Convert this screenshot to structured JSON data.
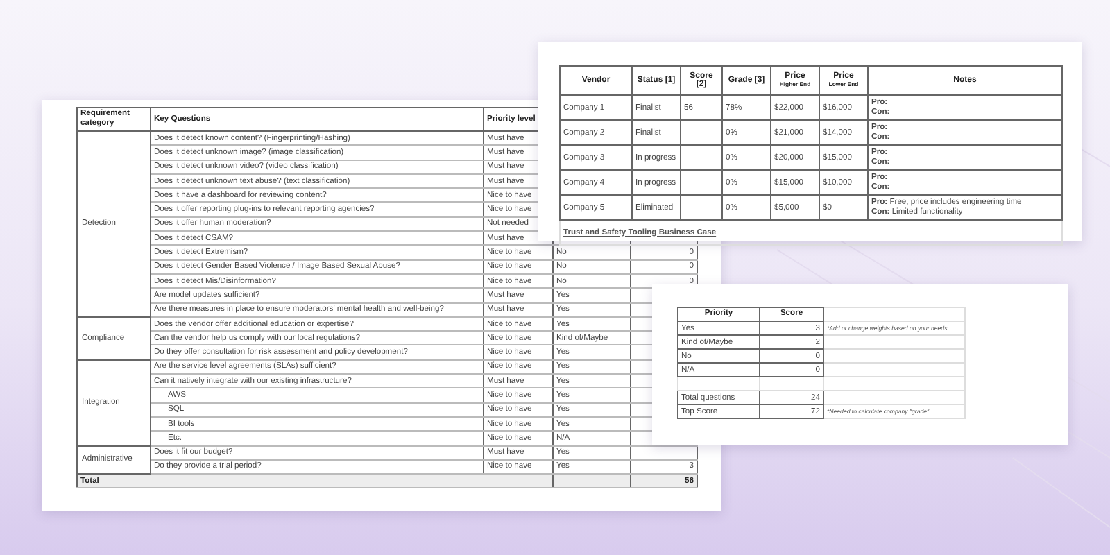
{
  "requirements_sheet": {
    "columns": [
      "Requirement category",
      "Key Questions",
      "Priority level"
    ],
    "categories": [
      {
        "name": "Detection",
        "rows": [
          {
            "question": "Does it detect known content? (Fingerprinting/Hashing)",
            "priority": "Must have"
          },
          {
            "question": "Does it detect unknown image? (image classification)",
            "priority": "Must have"
          },
          {
            "question": "Does it detect unknown video? (video classification)",
            "priority": "Must have"
          },
          {
            "question": "Does it detect unknown text abuse? (text classification)",
            "priority": "Must have"
          },
          {
            "question": "Does it have a dashboard for reviewing content?",
            "priority": "Nice to have"
          },
          {
            "question": "Does it offer reporting plug-ins to relevant reporting agencies?",
            "priority": "Nice to have"
          },
          {
            "question": "Does it offer human moderation?",
            "priority": "Not needed"
          },
          {
            "question": "Does it detect CSAM?",
            "priority": "Must have"
          },
          {
            "question": "Does it detect Extremism?",
            "priority": "Nice to have",
            "answer": "No",
            "score": "0"
          },
          {
            "question": "Does it detect Gender Based Violence / Image Based Sexual Abuse?",
            "priority": "Nice to have",
            "answer": "No",
            "score": "0"
          },
          {
            "question": "Does it detect Mis/Disinformation?",
            "priority": "Nice to have",
            "answer": "No",
            "score": "0"
          },
          {
            "question": "Are model updates sufficient?",
            "priority": "Must have",
            "answer": "Yes"
          },
          {
            "question": "Are there measures in place to ensure moderators' mental health and well-being?",
            "priority": "Must have",
            "answer": "Yes"
          }
        ]
      },
      {
        "name": "Compliance",
        "rows": [
          {
            "question": "Does the vendor offer additional education or expertise?",
            "priority": "Nice to have",
            "answer": "Yes"
          },
          {
            "question": "Can the vendor help us comply with our local regulations?",
            "priority": "Nice to have",
            "answer": "Kind of/Maybe"
          },
          {
            "question": "Do they offer consultation for risk assessment and policy development?",
            "priority": "Nice to have",
            "answer": "Yes"
          }
        ]
      },
      {
        "name": "Integration",
        "rows": [
          {
            "question": "Are the service level agreements (SLAs) sufficient?",
            "priority": "Nice to have",
            "answer": "Yes"
          },
          {
            "question": "Can it natively integrate with our existing infrastructure?",
            "priority": "Must have",
            "answer": "Yes",
            "children": [
              {
                "question": "AWS",
                "priority": "Nice to have",
                "answer": "Yes"
              },
              {
                "question": "SQL",
                "priority": "Nice to have",
                "answer": "Yes"
              },
              {
                "question": "BI tools",
                "priority": "Nice to have",
                "answer": "Yes"
              },
              {
                "question": "Etc.",
                "priority": "Nice to have",
                "answer": "N/A"
              }
            ]
          }
        ]
      },
      {
        "name": "Administrative",
        "rows": [
          {
            "question": "Does it fit our budget?",
            "priority": "Must have",
            "answer": "Yes"
          },
          {
            "question": "Do they provide a trial period?",
            "priority": "Nice to have",
            "answer": "Yes",
            "score": "3"
          }
        ]
      }
    ],
    "total": {
      "label": "Total",
      "score": "56"
    }
  },
  "vendor_sheet": {
    "columns": [
      {
        "label": "Vendor"
      },
      {
        "label": "Status [1]"
      },
      {
        "label": "Score [2]"
      },
      {
        "label": "Grade [3]"
      },
      {
        "label": "Price",
        "sub": "Higher End"
      },
      {
        "label": "Price",
        "sub": "Lower End"
      },
      {
        "label": "Notes"
      }
    ],
    "rows": [
      {
        "cells": [
          "Company 1",
          "Finalist",
          "56",
          "78%",
          "$22,000",
          "$16,000"
        ],
        "pro": "**Pro:**",
        "con": "**Con:**"
      },
      {
        "cells": [
          "Company 2",
          "Finalist",
          "",
          "0%",
          "$21,000",
          "$14,000"
        ],
        "pro": "**Pro:**",
        "con": "**Con:**"
      },
      {
        "cells": [
          "Company 3",
          "In progress",
          "",
          "0%",
          "$20,000",
          "$15,000"
        ],
        "pro": "**Pro:**",
        "con": "**Con:**"
      },
      {
        "cells": [
          "Company 4",
          "In progress",
          "",
          "0%",
          "$15,000",
          "$10,000"
        ],
        "pro": "**Pro:**",
        "con": "**Con:**"
      },
      {
        "cells": [
          "Company 5",
          "Eliminated",
          "",
          "0%",
          "$5,000",
          "$0"
        ],
        "pro": "**Pro:** Free, price includes engineering time",
        "con": "**Con:** Limited functionality"
      }
    ],
    "caption": "Trust and Safety Tooling Business Case"
  },
  "scoring_sheet": {
    "columns": [
      "Priority",
      "Score"
    ],
    "rows": [
      {
        "label": "Yes",
        "score": "3",
        "note": "*Add or change weights based on your needs"
      },
      {
        "label": "Kind of/Maybe",
        "score": "2"
      },
      {
        "label": "No",
        "score": "0"
      },
      {
        "label": "N/A",
        "score": "0"
      },
      {
        "kind": "blank"
      },
      {
        "label": "Total questions",
        "score": "24"
      },
      {
        "label": "Top Score",
        "score": "72",
        "note": "*Needed to calculate company \"grade\""
      }
    ]
  }
}
